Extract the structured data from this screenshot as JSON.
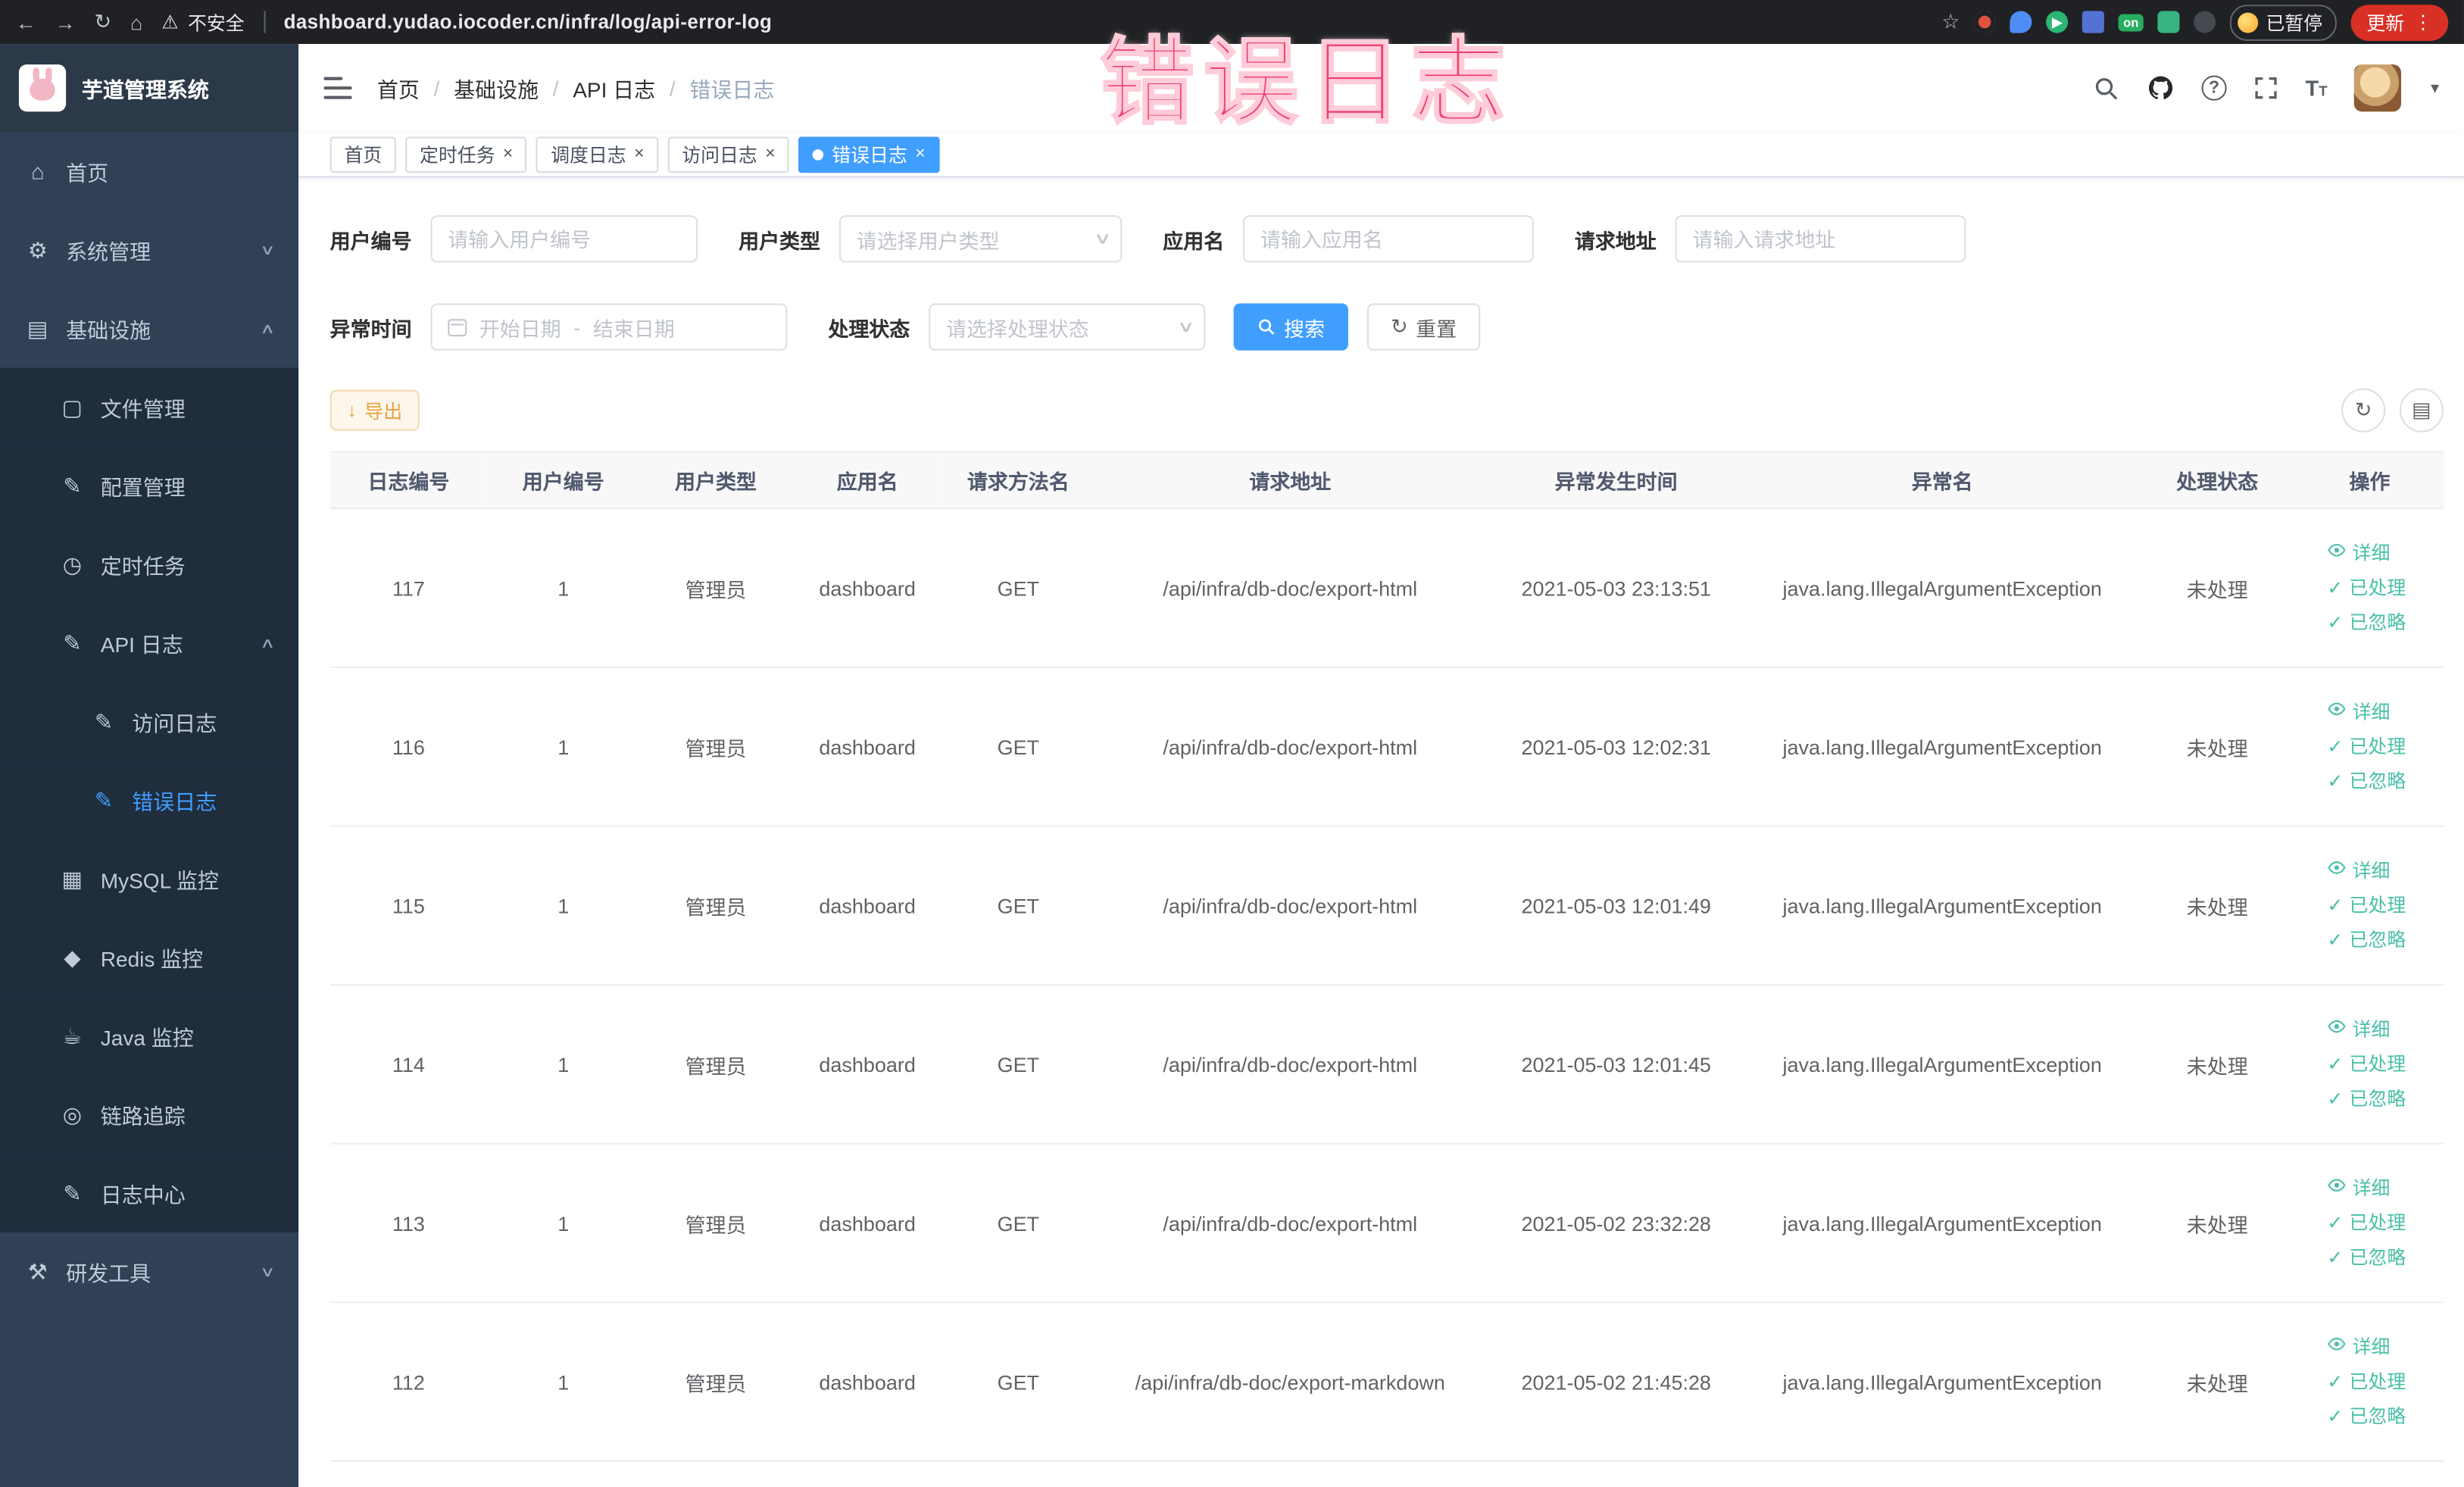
{
  "browser": {
    "security_label": "不安全",
    "url": "dashboard.yudao.iocoder.cn/infra/log/api-error-log",
    "paused_label": "已暂停",
    "update_label": "更新",
    "on_badge": "on"
  },
  "watermark_text": "错误日志",
  "sidebar": {
    "logo_title": "芋道管理系统",
    "items": [
      {
        "label": "首页",
        "level": 0,
        "icon": "home-icon"
      },
      {
        "label": "系统管理",
        "level": 0,
        "icon": "gear-icon",
        "chevron": "down"
      },
      {
        "label": "基础设施",
        "level": 0,
        "icon": "infrastructure-icon",
        "chevron": "up"
      },
      {
        "label": "文件管理",
        "level": 1,
        "icon": "file-icon"
      },
      {
        "label": "配置管理",
        "level": 1,
        "icon": "config-icon"
      },
      {
        "label": "定时任务",
        "level": 1,
        "icon": "schedule-icon"
      },
      {
        "label": "API 日志",
        "level": 1,
        "icon": "api-log-icon",
        "chevron": "up"
      },
      {
        "label": "访问日志",
        "level": 2,
        "icon": "access-log-icon"
      },
      {
        "label": "错误日志",
        "level": 2,
        "icon": "error-log-icon",
        "active": true
      },
      {
        "label": "MySQL 监控",
        "level": 1,
        "icon": "mysql-icon"
      },
      {
        "label": "Redis 监控",
        "level": 1,
        "icon": "redis-icon"
      },
      {
        "label": "Java 监控",
        "level": 1,
        "icon": "java-icon"
      },
      {
        "label": "链路追踪",
        "level": 1,
        "icon": "trace-icon"
      },
      {
        "label": "日志中心",
        "level": 1,
        "icon": "log-center-icon"
      },
      {
        "label": "研发工具",
        "level": 0,
        "icon": "tools-icon",
        "chevron": "down"
      }
    ]
  },
  "header": {
    "breadcrumb": [
      "首页",
      "基础设施",
      "API 日志",
      "错误日志"
    ]
  },
  "tabs": [
    {
      "label": "首页",
      "closable": false,
      "active": false
    },
    {
      "label": "定时任务",
      "closable": true,
      "active": false
    },
    {
      "label": "调度日志",
      "closable": true,
      "active": false
    },
    {
      "label": "访问日志",
      "closable": true,
      "active": false
    },
    {
      "label": "错误日志",
      "closable": true,
      "active": true
    }
  ],
  "filters": {
    "user_id_label": "用户编号",
    "user_id_placeholder": "请输入用户编号",
    "user_type_label": "用户类型",
    "user_type_placeholder": "请选择用户类型",
    "app_name_label": "应用名",
    "app_name_placeholder": "请输入应用名",
    "request_url_label": "请求地址",
    "request_url_placeholder": "请输入请求地址",
    "exception_time_label": "异常时间",
    "date_start_placeholder": "开始日期",
    "date_separator": "-",
    "date_end_placeholder": "结束日期",
    "process_status_label": "处理状态",
    "process_status_placeholder": "请选择处理状态",
    "search_button": "搜索",
    "reset_button": "重置"
  },
  "toolbar": {
    "export_button": "导出"
  },
  "table": {
    "columns": [
      "日志编号",
      "用户编号",
      "用户类型",
      "应用名",
      "请求方法名",
      "请求地址",
      "异常发生时间",
      "异常名",
      "处理状态",
      "操作"
    ],
    "actions": {
      "detail": "详细",
      "processed": "已处理",
      "ignored": "已忽略"
    },
    "rows": [
      {
        "id": "117",
        "user_id": "1",
        "user_type": "管理员",
        "app": "dashboard",
        "method": "GET",
        "url": "/api/infra/db-doc/export-html",
        "time": "2021-05-03 23:13:51",
        "exception": "java.lang.IllegalArgumentException",
        "status": "未处理"
      },
      {
        "id": "116",
        "user_id": "1",
        "user_type": "管理员",
        "app": "dashboard",
        "method": "GET",
        "url": "/api/infra/db-doc/export-html",
        "time": "2021-05-03 12:02:31",
        "exception": "java.lang.IllegalArgumentException",
        "status": "未处理"
      },
      {
        "id": "115",
        "user_id": "1",
        "user_type": "管理员",
        "app": "dashboard",
        "method": "GET",
        "url": "/api/infra/db-doc/export-html",
        "time": "2021-05-03 12:01:49",
        "exception": "java.lang.IllegalArgumentException",
        "status": "未处理"
      },
      {
        "id": "114",
        "user_id": "1",
        "user_type": "管理员",
        "app": "dashboard",
        "method": "GET",
        "url": "/api/infra/db-doc/export-html",
        "time": "2021-05-03 12:01:45",
        "exception": "java.lang.IllegalArgumentException",
        "status": "未处理"
      },
      {
        "id": "113",
        "user_id": "1",
        "user_type": "管理员",
        "app": "dashboard",
        "method": "GET",
        "url": "/api/infra/db-doc/export-html",
        "time": "2021-05-02 23:32:28",
        "exception": "java.lang.IllegalArgumentException",
        "status": "未处理"
      },
      {
        "id": "112",
        "user_id": "1",
        "user_type": "管理员",
        "app": "dashboard",
        "method": "GET",
        "url": "/api/infra/db-doc/export-markdown",
        "time": "2021-05-02 21:45:28",
        "exception": "java.lang.IllegalArgumentException",
        "status": "未处理"
      }
    ]
  }
}
